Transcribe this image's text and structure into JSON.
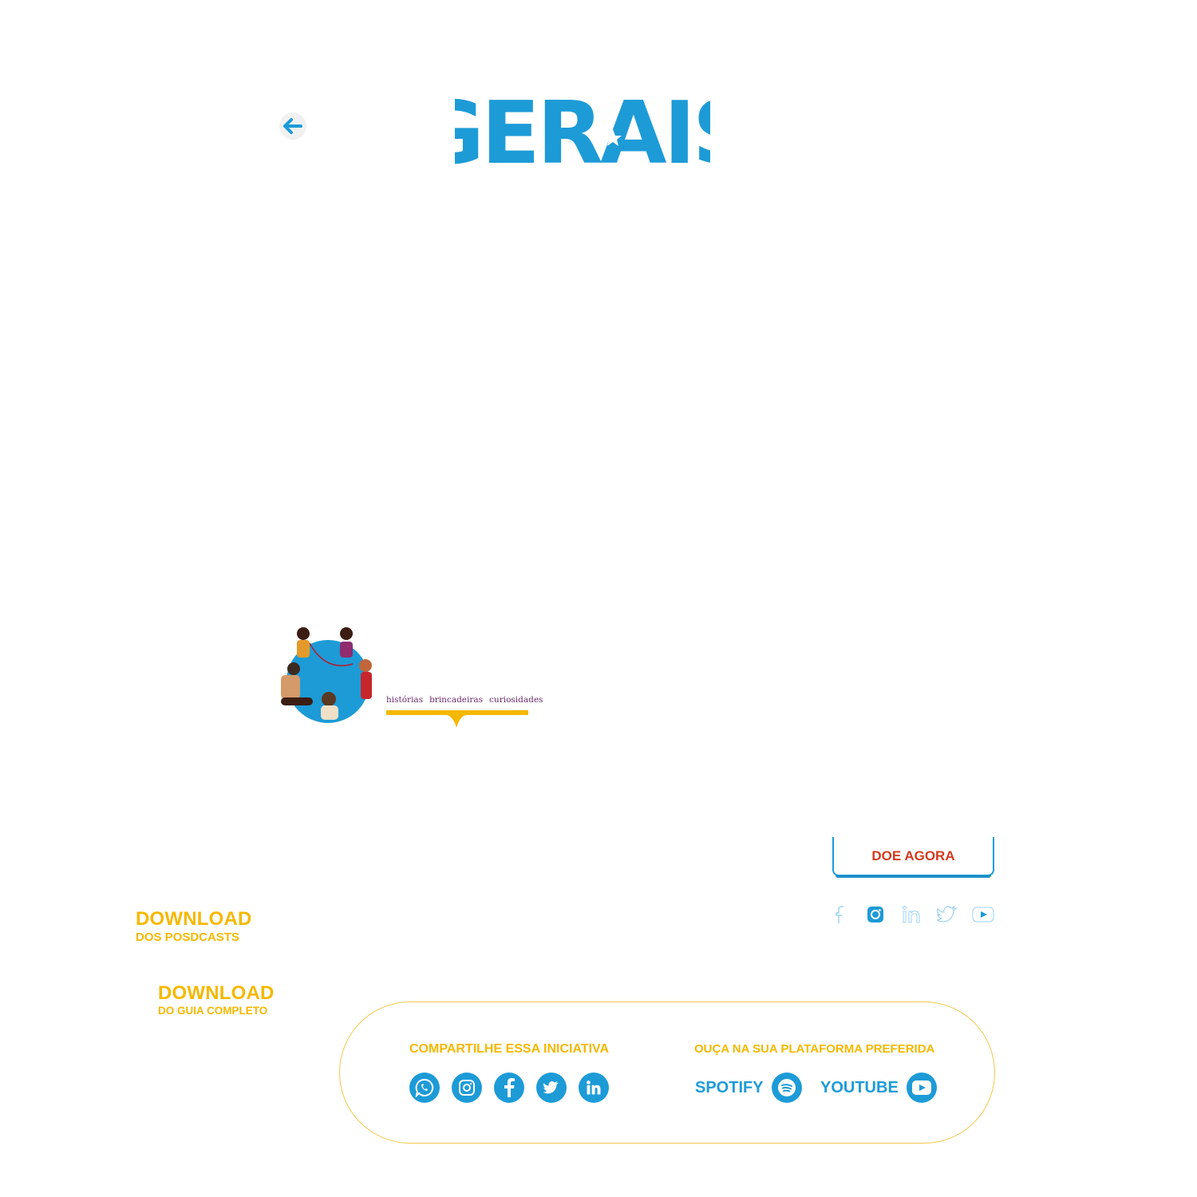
{
  "header": {
    "title": "GERAIS",
    "back_icon": "arrow-left-icon"
  },
  "brand": {
    "tags": [
      "histórias",
      "brincadeiras",
      "curiosidades"
    ]
  },
  "colors": {
    "primary_blue": "#1d9bd7",
    "accent_yellow": "#f5b800",
    "donate_red": "#d33a1f",
    "tag_purple": "#6b2a6b"
  },
  "actions": {
    "donate_label": "DOE AGORA"
  },
  "social_top": [
    "facebook-icon",
    "instagram-icon",
    "linkedin-icon",
    "twitter-icon",
    "youtube-icon"
  ],
  "downloads": {
    "podcasts": {
      "big": "DOWNLOAD",
      "small": "DOS POSDCASTS"
    },
    "guide": {
      "big": "DOWNLOAD",
      "small": "DO GUIA COMPLETO"
    }
  },
  "footer": {
    "share_title": "COMPARTILHE ESSA INICIATIVA",
    "share_icons": [
      "whatsapp-icon",
      "instagram-icon",
      "facebook-icon",
      "twitter-icon",
      "linkedin-icon"
    ],
    "listen_title": "OUÇA NA SUA PLATAFORMA PREFERIDA",
    "platforms": [
      {
        "label": "SPOTIFY",
        "icon": "spotify-icon"
      },
      {
        "label": "YOUTUBE",
        "icon": "youtube-icon"
      }
    ]
  }
}
